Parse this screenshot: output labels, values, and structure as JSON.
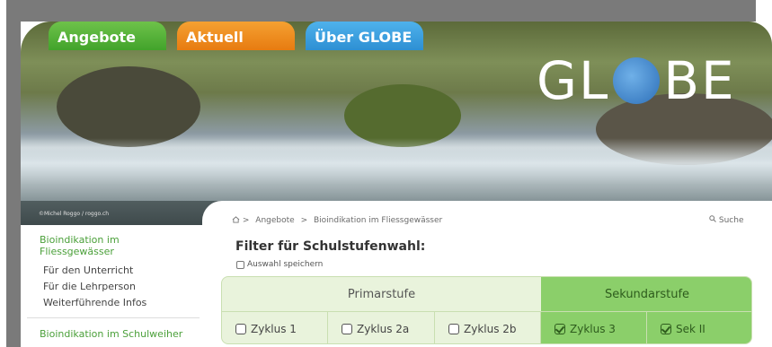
{
  "nav": {
    "tabs": [
      {
        "label": "Angebote",
        "color": "#4fb333"
      },
      {
        "label": "Aktuell",
        "color": "#ef8a1f"
      },
      {
        "label": "Über GLOBE",
        "color": "#3aa0e0"
      }
    ]
  },
  "hero": {
    "logo_left": "GL",
    "logo_right": "BE",
    "photo_credit": "©Michel Roggo / roggo.ch"
  },
  "breadcrumb": {
    "items": [
      "Angebote",
      "Bioindikation im Fliessgewässer"
    ],
    "separator": ">"
  },
  "search": {
    "label": "Suche"
  },
  "filter": {
    "title": "Filter für Schulstufenwahl:",
    "save_label": "Auswahl speichern",
    "groups": [
      {
        "label": "Primarstufe"
      },
      {
        "label": "Sekundarstufe"
      }
    ],
    "options": [
      {
        "label": "Zyklus 1",
        "checked": false
      },
      {
        "label": "Zyklus 2a",
        "checked": false
      },
      {
        "label": "Zyklus 2b",
        "checked": false
      },
      {
        "label": "Zyklus 3",
        "checked": true
      },
      {
        "label": "Sek II",
        "checked": true
      }
    ]
  },
  "sidebar": {
    "section1_title": "Bioindikation im Fliessgewässer",
    "section1_links": [
      "Für den Unterricht",
      "Für die Lehrperson",
      "Weiterführende Infos"
    ],
    "section2_title": "Bioindikation im Schulweiher"
  },
  "colors": {
    "accent_green": "#4ba03a",
    "selected_green": "#8bcf6a"
  }
}
